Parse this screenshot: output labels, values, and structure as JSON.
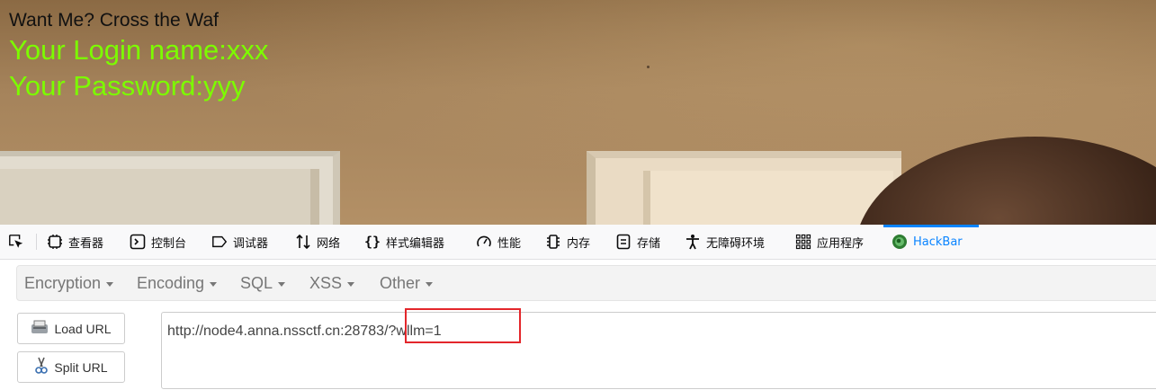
{
  "webpage": {
    "title": "Want Me? Cross the Waf",
    "login_line": "Your Login name:xxx",
    "password_line": "Your Password:yyy",
    "text_color": "#7cfc00"
  },
  "devtools": {
    "tabs": [
      {
        "label": "查看器",
        "icon": "inspector-icon"
      },
      {
        "label": "控制台",
        "icon": "console-icon"
      },
      {
        "label": "调试器",
        "icon": "debugger-icon"
      },
      {
        "label": "网络",
        "icon": "network-icon"
      },
      {
        "label": "样式编辑器",
        "icon": "style-editor-icon"
      },
      {
        "label": "性能",
        "icon": "performance-icon"
      },
      {
        "label": "内存",
        "icon": "memory-icon"
      },
      {
        "label": "存储",
        "icon": "storage-icon"
      },
      {
        "label": "无障碍环境",
        "icon": "accessibility-icon"
      },
      {
        "label": "应用程序",
        "icon": "application-icon"
      },
      {
        "label": "HackBar",
        "icon": "hackbar-icon",
        "active": true
      }
    ],
    "active_color": "#0a84ff"
  },
  "hackbar": {
    "menus": [
      "Encryption",
      "Encoding",
      "SQL",
      "XSS",
      "Other"
    ],
    "load_url_label": "Load URL",
    "split_url_label": "Split URL",
    "url_value": "http://node4.anna.nssctf.cn:28783/?wllm=1",
    "highlight_color": "#e3262b"
  }
}
